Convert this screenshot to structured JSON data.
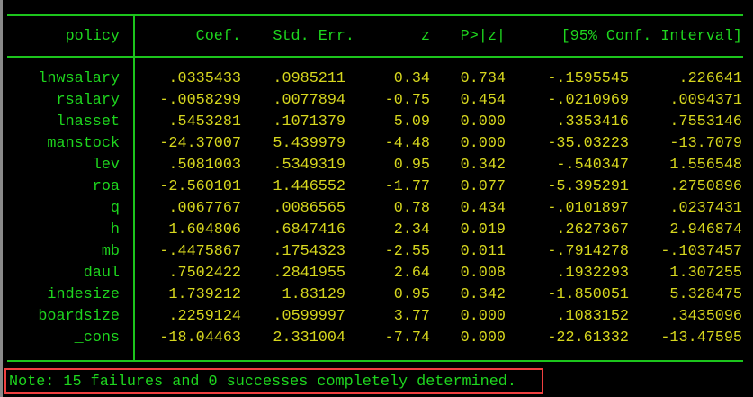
{
  "header": {
    "depvar": "policy",
    "columns": [
      "Coef.",
      "Std. Err.",
      "z",
      "P>|z|",
      "[95% Conf. Interval]"
    ]
  },
  "rows": [
    {
      "var": "lnwsalary",
      "coef": ".0335433",
      "se": ".0985211",
      "z": "0.34",
      "p": "0.734",
      "lo": "-.1595545",
      "hi": ".226641"
    },
    {
      "var": "rsalary",
      "coef": "-.0058299",
      "se": ".0077894",
      "z": "-0.75",
      "p": "0.454",
      "lo": "-.0210969",
      "hi": ".0094371"
    },
    {
      "var": "lnasset",
      "coef": ".5453281",
      "se": ".1071379",
      "z": "5.09",
      "p": "0.000",
      "lo": ".3353416",
      "hi": ".7553146"
    },
    {
      "var": "manstock",
      "coef": "-24.37007",
      "se": "5.439979",
      "z": "-4.48",
      "p": "0.000",
      "lo": "-35.03223",
      "hi": "-13.7079"
    },
    {
      "var": "lev",
      "coef": ".5081003",
      "se": ".5349319",
      "z": "0.95",
      "p": "0.342",
      "lo": "-.540347",
      "hi": "1.556548"
    },
    {
      "var": "roa",
      "coef": "-2.560101",
      "se": "1.446552",
      "z": "-1.77",
      "p": "0.077",
      "lo": "-5.395291",
      "hi": ".2750896"
    },
    {
      "var": "q",
      "coef": ".0067767",
      "se": ".0086565",
      "z": "0.78",
      "p": "0.434",
      "lo": "-.0101897",
      "hi": ".0237431"
    },
    {
      "var": "h",
      "coef": "1.604806",
      "se": ".6847416",
      "z": "2.34",
      "p": "0.019",
      "lo": ".2627367",
      "hi": "2.946874"
    },
    {
      "var": "mb",
      "coef": "-.4475867",
      "se": ".1754323",
      "z": "-2.55",
      "p": "0.011",
      "lo": "-.7914278",
      "hi": "-.1037457"
    },
    {
      "var": "daul",
      "coef": ".7502422",
      "se": ".2841955",
      "z": "2.64",
      "p": "0.008",
      "lo": ".1932293",
      "hi": "1.307255"
    },
    {
      "var": "indesize",
      "coef": "1.739212",
      "se": "1.83129",
      "z": "0.95",
      "p": "0.342",
      "lo": "-1.850051",
      "hi": "5.328475"
    },
    {
      "var": "boardsize",
      "coef": ".2259124",
      "se": ".0599997",
      "z": "3.77",
      "p": "0.000",
      "lo": ".1083152",
      "hi": ".3435096"
    },
    {
      "var": "_cons",
      "coef": "-18.04463",
      "se": "2.331004",
      "z": "-7.74",
      "p": "0.000",
      "lo": "-22.61332",
      "hi": "-13.47595"
    }
  ],
  "note": "Note: 15 failures and 0 successes completely determined.",
  "colors": {
    "label": "#1ed61e",
    "value": "#d7d71e",
    "rule": "#1cc41c",
    "highlight": "#f04040"
  }
}
